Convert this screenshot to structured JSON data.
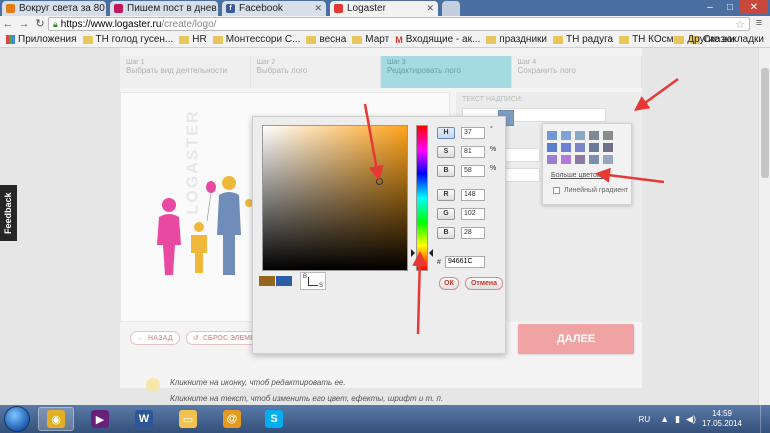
{
  "browser": {
    "tabs": [
      {
        "title": "Вокруг света за 80 д",
        "favicon_color": "#e57c14",
        "active": false
      },
      {
        "title": "Пишем пост в днев",
        "favicon_color": "#c2185b",
        "active": false
      },
      {
        "title": "Facebook",
        "favicon_color": "#3b5998",
        "active": false
      },
      {
        "title": "Logaster",
        "favicon_color": "#e53935",
        "active": true
      }
    ],
    "window_controls": {
      "minimize": "–",
      "maximize": "□",
      "close": "✕"
    },
    "url_host": "https://www.logaster.ru",
    "url_path": "/create/logo/",
    "bookmarks": [
      "Приложения",
      "ТН голод гусен...",
      "HR",
      "Монтессори С...",
      "весна",
      "Март",
      "Входящие - ак...",
      "праздники",
      "ТН радуга",
      "ТН КОсмос",
      "Сказки"
    ],
    "other_bookmarks": "Другие закладки"
  },
  "page": {
    "feedback_tab": "Feedback",
    "steps": [
      {
        "num": "Шаг 1",
        "label": "Выбрать вид деятельности",
        "active": false
      },
      {
        "num": "Шаг 2",
        "label": "Выбрать лого",
        "active": false
      },
      {
        "num": "Шаг 3",
        "label": "Редактировать лого",
        "active": true
      },
      {
        "num": "Шаг 4",
        "label": "Сохранить лого",
        "active": false
      }
    ],
    "watermark": "LOGASTER",
    "side_label": "Текст надписи:",
    "back_button": "НАЗАД",
    "reset_button": "СБРОС ЭЛЕМЕНТА",
    "next_button": "ДАЛЕЕ",
    "hints": [
      "Кликните на иконку, чтоб редактировать ее.",
      "Кликните на текст, чтоб изменить его цвет, ефекты, шрифт и т. п."
    ]
  },
  "color_picker": {
    "fields": [
      {
        "key": "H",
        "value": "37",
        "unit": "°",
        "selected": true
      },
      {
        "key": "S",
        "value": "81",
        "unit": "%",
        "selected": false
      },
      {
        "key": "B",
        "value": "58",
        "unit": "%",
        "selected": false
      },
      {
        "key": "R",
        "value": "148",
        "unit": "",
        "selected": false
      },
      {
        "key": "G",
        "value": "102",
        "unit": "",
        "selected": false
      },
      {
        "key": "B",
        "value": "28",
        "unit": "",
        "selected": false
      }
    ],
    "hex_label": "#",
    "hex_value": "94661C",
    "mini_b": "B",
    "mini_s": "S",
    "ok_button": "ОК",
    "cancel_button": "Отмена",
    "new_color": "#94661c",
    "old_color": "#2b5ea6"
  },
  "palette": {
    "swatches": [
      "#6f9ad6",
      "#7ea4d6",
      "#8aa8c8",
      "#7f8a99",
      "#8c8c8c",
      "#5b7fd0",
      "#6a7fd6",
      "#7a86c8",
      "#6b7a9a",
      "#6f6f8a",
      "#9a7fd0",
      "#b07ad6",
      "#8a7aa8",
      "#7a8fb0",
      "#95a6c0"
    ],
    "more_colors": "Больше цветов...",
    "linear_gradient": "Линейный градиент",
    "current_swatch": "#7f9dc4"
  },
  "taskbar": {
    "apps": [
      {
        "name": "chrome",
        "color": "#e3b021",
        "glyph": "◉",
        "active": true
      },
      {
        "name": "visual-studio",
        "color": "#68217a",
        "glyph": "▶",
        "active": false
      },
      {
        "name": "word",
        "color": "#2b579a",
        "glyph": "W",
        "active": false
      },
      {
        "name": "explorer",
        "color": "#f2c14e",
        "glyph": "▭",
        "active": false
      },
      {
        "name": "mail",
        "color": "#e59a1c",
        "glyph": "@",
        "active": false
      },
      {
        "name": "skype",
        "color": "#00aff0",
        "glyph": "S",
        "active": false
      }
    ],
    "language": "RU",
    "time": "14:59",
    "date": "17.05.2014"
  },
  "annotation_color": "#e53935"
}
